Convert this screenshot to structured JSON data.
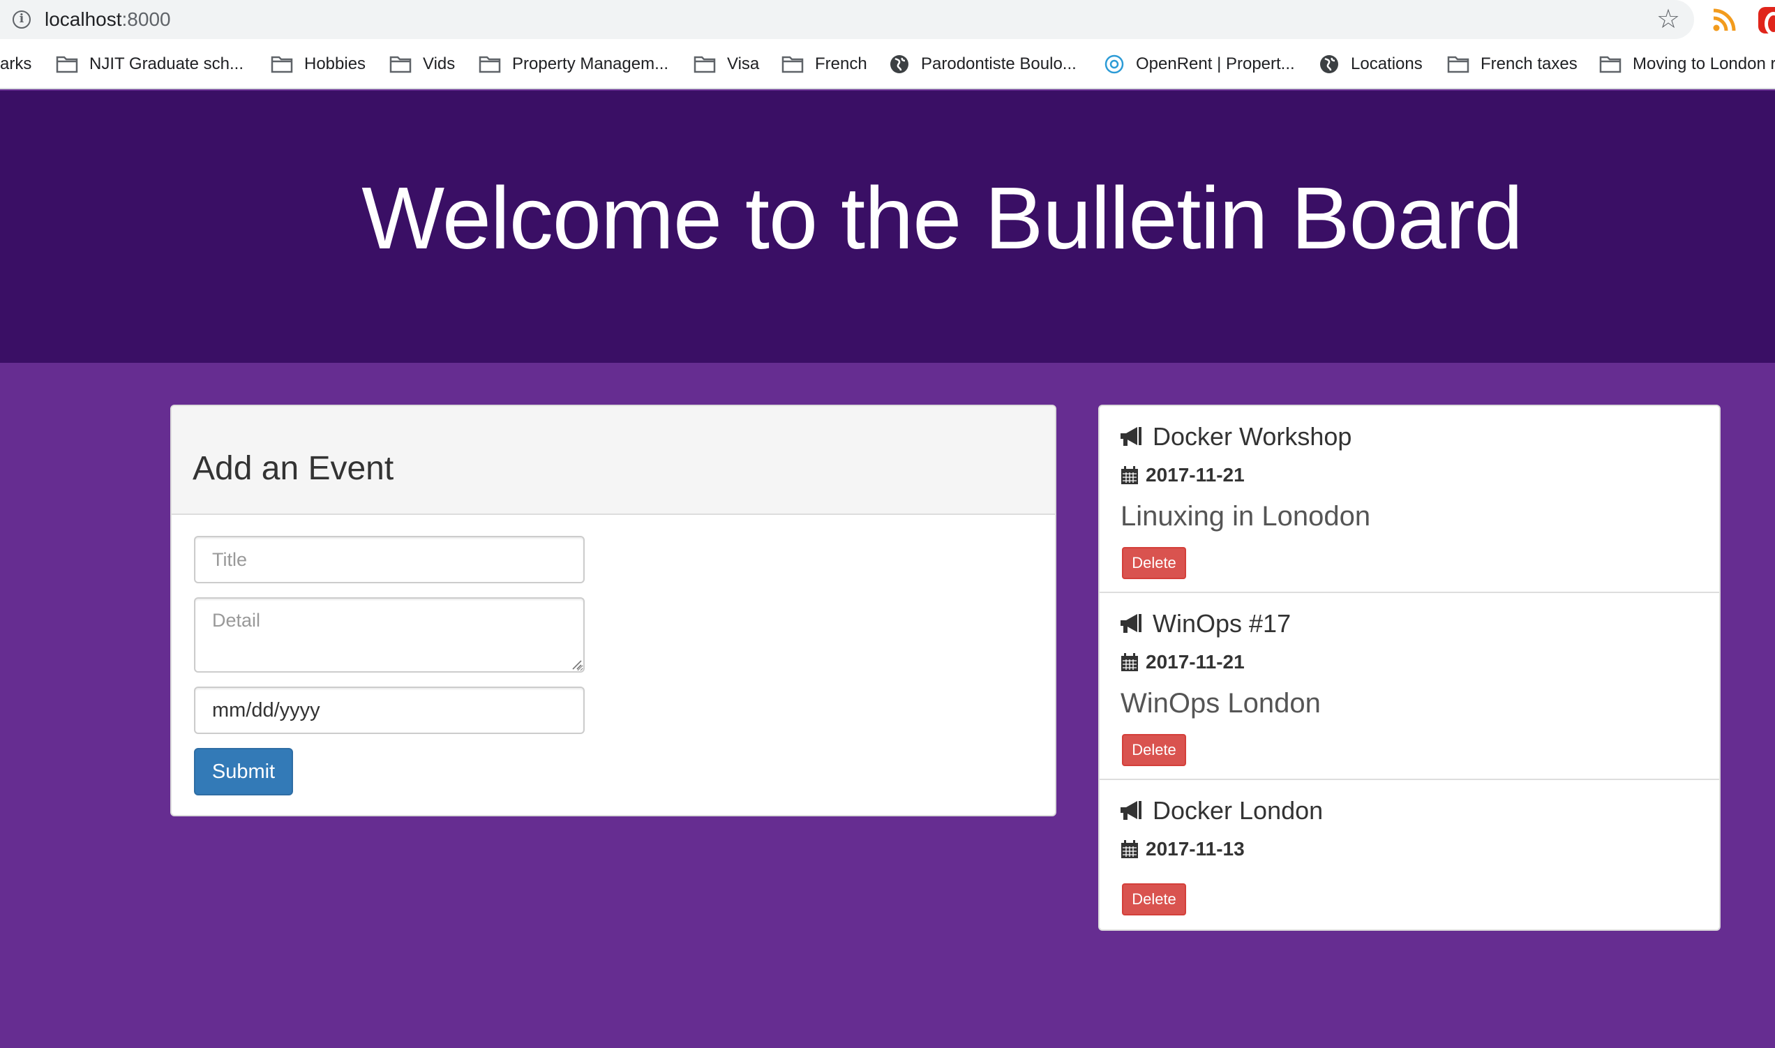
{
  "browser": {
    "url_host": "localhost",
    "url_port": ":8000",
    "bookmarks": [
      {
        "label": "arks",
        "icon": "none"
      },
      {
        "label": "NJIT Graduate sch...",
        "icon": "folder-icon"
      },
      {
        "label": "Hobbies",
        "icon": "folder-icon"
      },
      {
        "label": "Vids",
        "icon": "folder-icon"
      },
      {
        "label": "Property Managem...",
        "icon": "folder-icon"
      },
      {
        "label": "Visa",
        "icon": "folder-icon"
      },
      {
        "label": "French",
        "icon": "folder-icon"
      },
      {
        "label": "Parodontiste Boulo...",
        "icon": "globe-icon"
      },
      {
        "label": "OpenRent | Propert...",
        "icon": "openrent-icon"
      },
      {
        "label": "Locations",
        "icon": "globe-icon"
      },
      {
        "label": "French taxes",
        "icon": "folder-icon"
      },
      {
        "label": "Moving to London r",
        "icon": "folder-icon"
      }
    ]
  },
  "page": {
    "heading": "Welcome to the Bulletin Board"
  },
  "form": {
    "title": "Add an Event",
    "title_placeholder": "Title",
    "detail_placeholder": "Detail",
    "date_placeholder": "mm/dd/yyyy",
    "submit_label": "Submit"
  },
  "events": [
    {
      "title": "Docker Workshop",
      "date": "2017-11-21",
      "detail": "Linuxing in Lonodon",
      "delete_label": "Delete"
    },
    {
      "title": "WinOps #17",
      "date": "2017-11-21",
      "detail": "WinOps London",
      "delete_label": "Delete"
    },
    {
      "title": "Docker London",
      "date": "2017-11-13",
      "detail": "",
      "delete_label": "Delete"
    }
  ],
  "colors": {
    "jumbotron": "#3a0f65",
    "background": "#662d91",
    "primary_button": "#337ab7",
    "danger_button": "#d9534f"
  }
}
